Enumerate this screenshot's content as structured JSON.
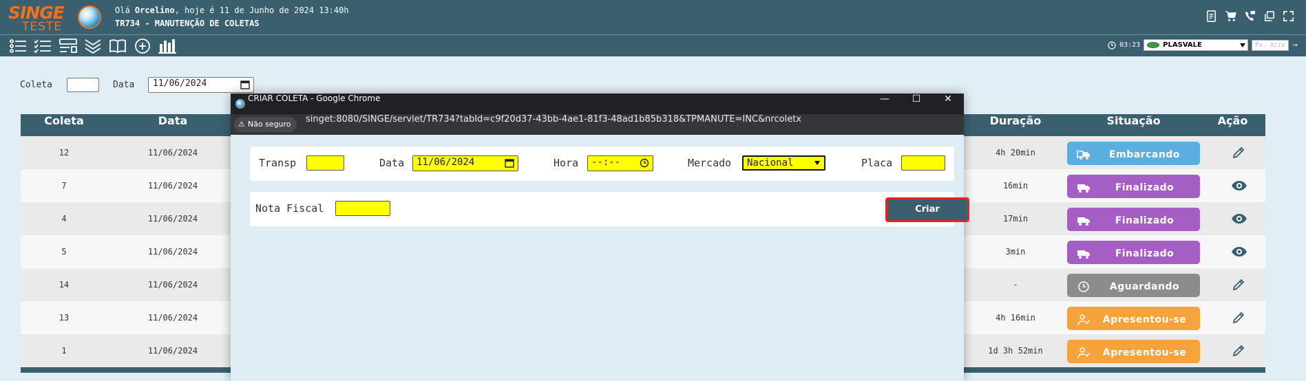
{
  "app": {
    "logo_top": "SINGE",
    "logo_bottom": "TESTE",
    "greeting_prefix": "Olá ",
    "user_name": "Orcelino",
    "greeting_suffix": ", hoje é 11 de Junho de 2024 13:40h",
    "screen_title": "TR734 - MANUTENÇÃO DE COLETAS",
    "session_time": "03:23",
    "company": "PLASVALE",
    "px_ativ_placeholder": "Px. Ativ"
  },
  "filters": {
    "coleta_label": "Coleta",
    "coleta_value": "",
    "data_label": "Data",
    "data_value": "11/06/2024"
  },
  "table": {
    "headers": {
      "coleta": "Coleta",
      "data": "Data",
      "duracao": "Duração",
      "situacao": "Situação",
      "acao": "Ação"
    },
    "rows": [
      {
        "coleta": "12",
        "data": "11/06/2024",
        "duracao": "4h 20min",
        "situacao": "Embarcando",
        "status_icon": "truck-loading-icon",
        "action": "edit-icon"
      },
      {
        "coleta": "7",
        "data": "11/06/2024",
        "duracao": "16min",
        "situacao": "Finalizado",
        "status_icon": "truck-icon",
        "action": "view-icon"
      },
      {
        "coleta": "4",
        "data": "11/06/2024",
        "duracao": "17min",
        "situacao": "Finalizado",
        "status_icon": "truck-icon",
        "action": "view-icon"
      },
      {
        "coleta": "5",
        "data": "11/06/2024",
        "duracao": "3min",
        "situacao": "Finalizado",
        "status_icon": "truck-icon",
        "action": "view-icon"
      },
      {
        "coleta": "14",
        "data": "11/06/2024",
        "duracao": "-",
        "situacao": "Aguardando",
        "status_icon": "clock-icon",
        "action": "edit-icon"
      },
      {
        "coleta": "13",
        "data": "11/06/2024",
        "duracao": "4h 16min",
        "situacao": "Apresentou-se",
        "status_icon": "person-icon",
        "action": "edit-icon"
      },
      {
        "coleta": "1",
        "data": "11/06/2024",
        "duracao": "1d 3h 52min",
        "situacao": "Apresentou-se",
        "status_icon": "person-icon",
        "action": "edit-icon"
      }
    ]
  },
  "status_colors": {
    "Embarcando": "#5aaee0",
    "Finalizado": "#a55fc4",
    "Aguardando": "#8c8c8c",
    "Apresentou-se": "#f5a33a"
  },
  "modal": {
    "window_title": "CRIAR COLETA - Google Chrome",
    "security_label": "Não seguro",
    "url": "singet:8080/SINGE/servlet/TR734?tabId=c9f20d37-43bb-4ae1-81f3-48ad1b85b318&TPMANUTE=INC&nrcoletx",
    "form": {
      "transp_label": "Transp",
      "transp_value": "",
      "data_label": "Data",
      "data_value": "11/06/2024",
      "hora_label": "Hora",
      "hora_value": "--:--",
      "mercado_label": "Mercado",
      "mercado_value": "Nacional",
      "placa_label": "Placa",
      "placa_value": "",
      "nota_fiscal_label": "Nota Fiscal",
      "nota_fiscal_value": "",
      "criar_label": "Criar"
    }
  }
}
